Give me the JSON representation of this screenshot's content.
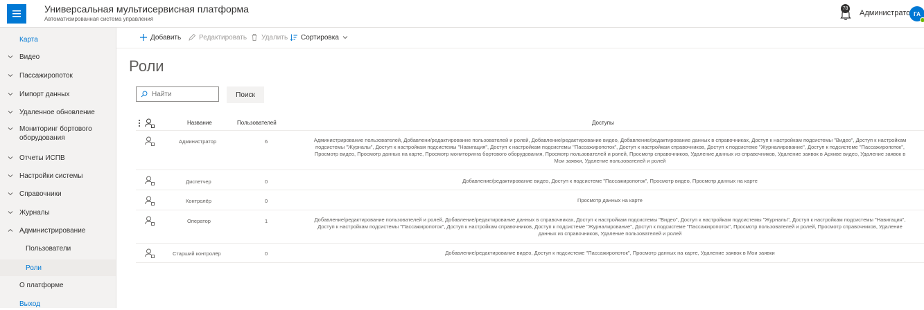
{
  "header": {
    "title": "Универсальная мультисервисная платформа",
    "subtitle": "Автоматизированная система управления",
    "notification_count": "78",
    "user_name": "Администратор",
    "avatar_initials": "ГА"
  },
  "sidebar": {
    "items": [
      {
        "label": "Карта"
      },
      {
        "label": "Видео"
      },
      {
        "label": "Пассажиропоток"
      },
      {
        "label": "Импорт данных"
      },
      {
        "label": "Удаленное обновление"
      },
      {
        "label": "Мониторинг бортового оборудования"
      },
      {
        "label": "Отчеты ИСПВ"
      },
      {
        "label": "Настройки системы"
      },
      {
        "label": "Справочники"
      },
      {
        "label": "Журналы"
      },
      {
        "label": "Администрирование"
      },
      {
        "label": "Пользователи"
      },
      {
        "label": "Роли"
      },
      {
        "label": "О платформе"
      },
      {
        "label": "Выход"
      }
    ]
  },
  "toolbar": {
    "add": "Добавить",
    "edit": "Редактировать",
    "delete": "Удалить",
    "sort": "Сортировка"
  },
  "page": {
    "title": "Роли",
    "search_placeholder": "Найти",
    "search_button": "Поиск"
  },
  "table": {
    "columns": {
      "name": "Название",
      "users": "Пользователей",
      "access": "Доступы"
    },
    "rows": [
      {
        "name": "Администратор",
        "users": "6",
        "access_lines": [
          "Администрирование пользователей, Добавлени/редактирование пользователей и ролей, Добавление/редактирование видео, Добавление/редактирование данных в справочниках, Доступ к настройкам подсистемы \"Видео\", Доступ к настройкам",
          "подсистемы \"Журналы\", Доступ к настройкам подсистемы \"Навигация\", Доступ к настройкам подсистемы \"Пассажиропоток\", Доступ к настройкам справочников, Доступ к подсистеме \"Журналирование\", Доступ к подсистеме \"Пассажиропоток\",",
          "Просмотр видео, Просмотр данных на карте, Просмотр мониторинга бортового оборудования, Просмотр пользователей и ролей, Просмотр справочников, Удаление данных из справочников, Удаление заявок в Архиве видео, Удаление заявок в",
          "Мои заявки, Удаление пользователей и ролей"
        ]
      },
      {
        "name": "Диспетчер",
        "users": "0",
        "access_lines": [
          "Добавление/редактирование видео, Доступ к подсистеме \"Пассажиропоток\", Просмотр видео, Просмотр данных на карте"
        ]
      },
      {
        "name": "Контролёр",
        "users": "0",
        "access_lines": [
          "Просмотр данных на карте"
        ]
      },
      {
        "name": "Оператор",
        "users": "1",
        "access_lines": [
          "Добавление/редактирование пользователей и ролей, Добавление/редактирование данных в справочниках, Доступ к настройкам подсистемы \"Видео\", Доступ к настройкам подсистемы \"Журналы\", Доступ к настройкам подсистемы \"Навигация\",",
          "Доступ к настройкам подсистемы \"Пассажиропоток\", Доступ к настройкам справочников, Доступ к подсистеме \"Журналирование\", Доступ к подсистеме \"Пассажиропоток\", Просмотр пользователей и ролей, Просмотр справочников, Удаление",
          "данных из справочников, Удаление пользователей и ролей"
        ]
      },
      {
        "name": "Старший контролёр",
        "users": "0",
        "access_lines": [
          "Добавление/редактирование видео, Доступ к подсистеме \"Пассажиропоток\", Просмотр данных на карте, Удаление заявок в Мои заявки"
        ]
      }
    ]
  },
  "colors": {
    "accent": "#0078d4",
    "sidebar_bg": "#f3f2f1",
    "text": "#323130",
    "muted": "#605e5c"
  }
}
